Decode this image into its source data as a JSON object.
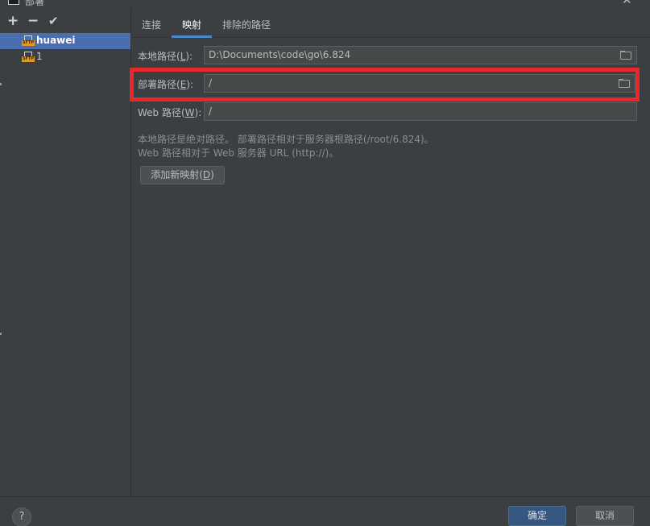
{
  "window": {
    "title": "部署"
  },
  "toolbar": {
    "add": "+",
    "remove": "−",
    "apply": "✔"
  },
  "servers": [
    {
      "label": "huawei",
      "icon": "sftp-server-icon",
      "selected": true
    },
    {
      "label": "1",
      "icon": "sftp-server-icon",
      "selected": false
    }
  ],
  "sftp_tag": "SFTP",
  "tabs": [
    {
      "label": "连接"
    },
    {
      "label": "映射",
      "active": true
    },
    {
      "label": "排除的路径"
    }
  ],
  "fields": {
    "local_path": {
      "label_pre": "本地路径(",
      "mnemonic": "L",
      "label_post": "):",
      "value": "D:\\Documents\\code\\go\\6.824"
    },
    "deploy_path": {
      "label_pre": "部署路径(",
      "mnemonic": "E",
      "label_post": "):",
      "value": "/"
    },
    "web_path": {
      "label_pre": "Web 路径(",
      "mnemonic": "W",
      "label_post": "):",
      "value": "/"
    }
  },
  "help": {
    "line1": "本地路径是绝对路径。 部署路径相对于服务器根路径(/root/6.824)。",
    "line2": "Web 路径相对于 Web 服务器 URL (http://)。"
  },
  "add_mapping": {
    "label_pre": "添加新映射(",
    "mnemonic": "D",
    "label_post": ")"
  },
  "footer": {
    "help": "?",
    "ok": "确定",
    "cancel": "取消"
  },
  "colors": {
    "highlight": "#e8282b",
    "selection": "#4b6eaf",
    "accent": "#4a88c7",
    "primary_button": "#365880"
  }
}
